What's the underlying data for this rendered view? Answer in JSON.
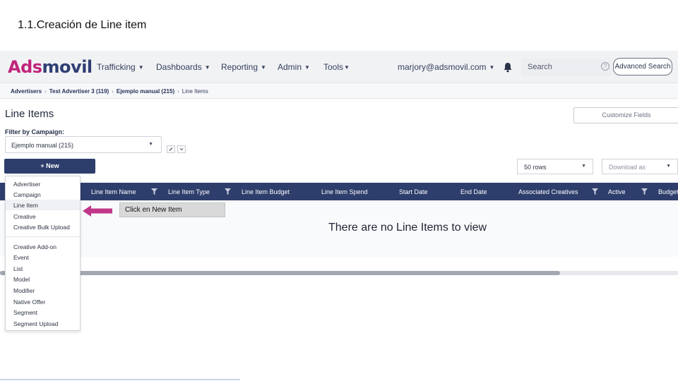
{
  "slide": {
    "title": "1.1.Creación de Line item"
  },
  "brand": {
    "part1": "Ads",
    "part2": "movil",
    "color1": "#c0247b",
    "color2": "#2f3f73"
  },
  "navbar": {
    "items": [
      "Trafficking",
      "Dashboards",
      "Reporting",
      "Admin",
      "Tools"
    ],
    "user": "marjory@adsmovil.com",
    "search_placeholder": "Search",
    "help": "?",
    "advanced_search": "Advanced Search"
  },
  "breadcrumb": [
    "Advertisers",
    "Test Advertiser 3 (119)",
    "Ejemplo manual (215)",
    "Line Items"
  ],
  "page": {
    "title": "Line Items",
    "customize_fields": "Customize Fields",
    "filter_label": "Filter by Campaign:",
    "campaign_value": "Ejemplo manual (215)",
    "new_button": "+ New",
    "rows_value": "50 rows",
    "download_placeholder": "Download as"
  },
  "table": {
    "columns": [
      "Line Item Name",
      "Line Item Type",
      "Line Item Budget",
      "Line Item Spend",
      "Start Date",
      "End Date",
      "Associated Creatives",
      "Active",
      "Budget"
    ],
    "empty_message": "There are no Line Items to view"
  },
  "new_menu": {
    "group1": [
      "Advertiser",
      "Campaign",
      "Line Item",
      "Creative",
      "Creative Bulk Upload"
    ],
    "group2": [
      "Creative Add-on",
      "Event",
      "List",
      "Model",
      "Modifier",
      "Native Offer",
      "Segment",
      "Segment Upload"
    ],
    "highlighted": "Line Item"
  },
  "annotation": {
    "text": "Click en New Item",
    "arrow_color": "#c0378a"
  },
  "colors": {
    "header_bg": "#2e3e6c",
    "accent": "#c0247b"
  }
}
